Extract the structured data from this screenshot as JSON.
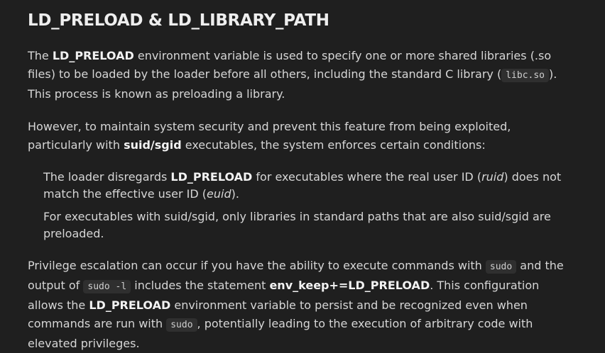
{
  "heading": "LD_PRELOAD & LD_LIBRARY_PATH",
  "p1": {
    "t1": "The ",
    "b1": "LD_PRELOAD",
    "t2": " environment variable is used to specify one or more shared libraries (.so files) to be loaded by the loader before all others, including the standard C library (",
    "code1": "libc.so",
    "t3": "). This process is known as preloading a library."
  },
  "p2": {
    "t1": "However, to maintain system security and prevent this feature from being exploited, particularly with ",
    "b1": "suid/sgid",
    "t2": " executables, the system enforces certain conditions:"
  },
  "conditions": [
    {
      "t1": "The loader disregards ",
      "b1": "LD_PRELOAD",
      "t2": " for executables where the real user ID (",
      "e1": "ruid",
      "t3": ") does not match the effective user ID (",
      "e2": "euid",
      "t4": ")."
    },
    {
      "t1": "For executables with suid/sgid, only libraries in standard paths that are also suid/sgid are preloaded."
    }
  ],
  "p3": {
    "t1": "Privilege escalation can occur if you have the ability to execute commands with ",
    "code1": "sudo",
    "t2": " and the output of ",
    "code2": "sudo -l",
    "t3": " includes the statement ",
    "b1": "env_keep+=LD_PRELOAD",
    "t4": ". This configuration allows the ",
    "b2": "LD_PRELOAD",
    "t5": " environment variable to persist and be recognized even when commands are run with ",
    "code3": "sudo",
    "t6": ", potentially leading to the execution of arbitrary code with elevated privileges."
  }
}
